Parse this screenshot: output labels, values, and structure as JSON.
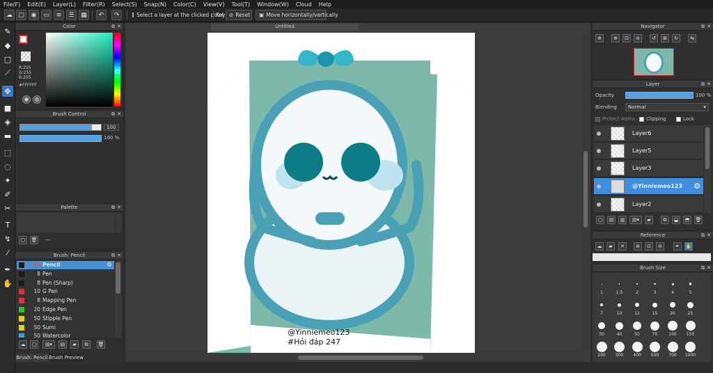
{
  "menu": [
    "File(F)",
    "Edit(E)",
    "Layer(L)",
    "Filter(R)",
    "Select(S)",
    "Snap(N)",
    "Color(C)",
    "View(V)",
    "Tool(T)",
    "Window(W)",
    "Cloud",
    "Help"
  ],
  "toolbar": {
    "select_layer": "Select a layer at the clicked point",
    "key_label": "Key",
    "reset": "Reset",
    "move": "Move horizontally/vertically"
  },
  "canvas": {
    "tab_title": "Untitled",
    "watermark_line1": "@Yinniemeo123",
    "watermark_line2": "#Hỏi đáp 247"
  },
  "color_panel": {
    "title": "Color",
    "r": "R:255",
    "g": "G:255",
    "b": "B:255",
    "hex": "#FFFFFF"
  },
  "brush_control": {
    "title": "Brush Control",
    "size_value": "100",
    "opacity_value": "100 %"
  },
  "palette": {
    "title": "Palette",
    "name": "---"
  },
  "brush_panel": {
    "title": "Brush: Pencil",
    "items": [
      {
        "size": "100",
        "name": "Pencil",
        "color": "#1a1a1a"
      },
      {
        "size": "8",
        "name": "Pen",
        "color": "#1a1a1a"
      },
      {
        "size": "8",
        "name": "Pen (Sharp)",
        "color": "#1a1a1a"
      },
      {
        "size": "10",
        "name": "G Pen",
        "color": "#e03030"
      },
      {
        "size": "8",
        "name": "Mapping Pen",
        "color": "#e03030"
      },
      {
        "size": "20",
        "name": "Edge Pen",
        "color": "#30c030"
      },
      {
        "size": "50",
        "name": "Stipple Pen",
        "color": "#e0d020"
      },
      {
        "size": "50",
        "name": "Sumi",
        "color": "#e0d020"
      },
      {
        "size": "50",
        "name": "Watercolor",
        "color": "#40a0e0"
      }
    ],
    "tabs": [
      "Brush: Pencil",
      "Brush Preview"
    ]
  },
  "navigator": {
    "title": "Navigator"
  },
  "layer_panel": {
    "title": "Layer",
    "opacity_label": "Opacity",
    "opacity_value": "100 %",
    "blending_label": "Blending",
    "blending_value": "Normal",
    "protect_alpha": "Protect Alpha",
    "clipping": "Clipping",
    "lock": "Lock",
    "layers": [
      "Layer6",
      "Layer5",
      "Layer3",
      "@Yinniemeo123",
      "Layer2"
    ]
  },
  "reference": {
    "title": "Reference"
  },
  "brush_size": {
    "title": "Brush Size",
    "sizes": [
      "1",
      "1.5",
      "2",
      "3",
      "4",
      "5",
      "7",
      "10",
      "12",
      "15",
      "20",
      "25",
      "30",
      "40",
      "50",
      "70",
      "100",
      "150",
      "200",
      "300",
      "400",
      "500",
      "700",
      "1000"
    ]
  },
  "colors": {
    "accent": "#3b7ac3",
    "selected_layer": "#3f8ee0",
    "canvas_bg": "#7db9ab",
    "character": "#4aa1b5"
  }
}
